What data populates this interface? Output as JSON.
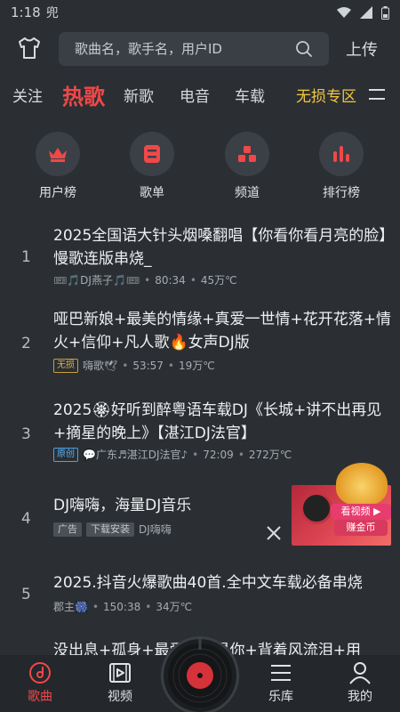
{
  "status": {
    "time": "1:18",
    "notif": "兜"
  },
  "search": {
    "placeholder": "歌曲名，歌手名，用户ID",
    "upload_label": "上传"
  },
  "tabs": [
    {
      "label": "关注"
    },
    {
      "label": "热歌"
    },
    {
      "label": "新歌"
    },
    {
      "label": "电音"
    },
    {
      "label": "车载"
    },
    {
      "label": "无损专区"
    }
  ],
  "categories": [
    {
      "label": "用户榜",
      "icon": "crown-icon"
    },
    {
      "label": "歌单",
      "icon": "playlist-icon"
    },
    {
      "label": "频道",
      "icon": "channel-icon"
    },
    {
      "label": "排行榜",
      "icon": "chart-icon"
    }
  ],
  "songs": [
    {
      "rank": "1",
      "title": "2025全国语大针头烟嗓翻唱【你看你看月亮的脸】慢歌连版串烧_",
      "author": "🎟🎵DJ燕子🎵🎟",
      "duration": "80:34",
      "plays": "45万℃"
    },
    {
      "rank": "2",
      "title": "哑巴新娘+最美的情缘+真爱一世情+花开花落+情火+信仰+凡人歌🔥女声DJ版",
      "badge": "无损",
      "author": "嗨歌🕊",
      "duration": "53:57",
      "plays": "19万℃"
    },
    {
      "rank": "3",
      "title": "2025🏵好听到醉粤语车载DJ《长城+讲不出再见+摘星的晚上》【湛江DJ法官】",
      "badge": "原创",
      "author": "💬广东♬湛江DJ法官♪",
      "duration": "72:09",
      "plays": "272万℃"
    },
    {
      "rank": "4",
      "title": "DJ嗨嗨，海量DJ音乐",
      "ad_label": "广告",
      "dl_label": "下载安装",
      "author": "DJ嗨嗨",
      "ad_cta_1": "看视频 ▶",
      "ad_cta_2": "赚金币"
    },
    {
      "rank": "5",
      "title": "2025.抖音火爆歌曲40首.全中文车载必备串烧",
      "author": "郡主🎆",
      "duration": "150:38",
      "plays": "34万℃"
    },
    {
      "rank": "6",
      "title": "没出息+孤身+最爱的人是你+背着风流泪+用"
    }
  ],
  "nav": [
    {
      "label": "歌曲",
      "icon": "music-disc-icon"
    },
    {
      "label": "视频",
      "icon": "video-icon"
    },
    {
      "label": "乐库",
      "icon": "library-icon"
    },
    {
      "label": "我的",
      "icon": "user-icon"
    }
  ],
  "colors": {
    "accent": "#f04848",
    "gold": "#f2c642",
    "bg": "#2b2f33"
  }
}
